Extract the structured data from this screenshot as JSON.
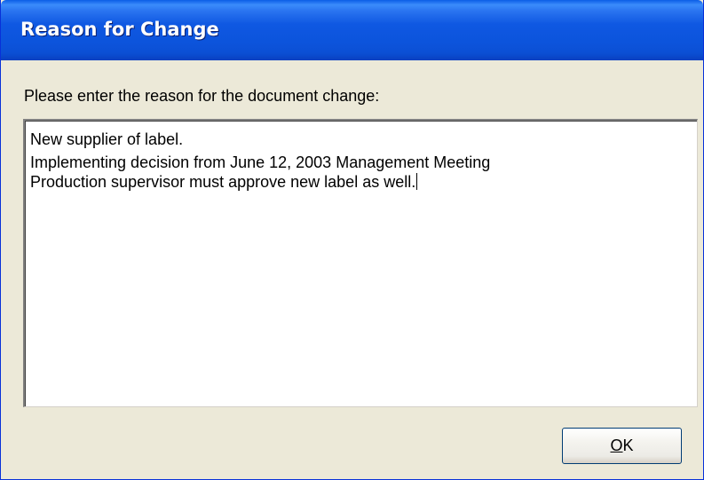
{
  "window": {
    "title": "Reason for Change"
  },
  "prompt": {
    "label": "Please enter the reason for the document change:"
  },
  "reason_field": {
    "lines": [
      "New supplier of label.",
      "Implementing decision from June 12, 2003 Management Meeting",
      "Production supervisor must approve new label as well."
    ]
  },
  "buttons": {
    "ok_accel": "O",
    "ok_rest": "K"
  }
}
